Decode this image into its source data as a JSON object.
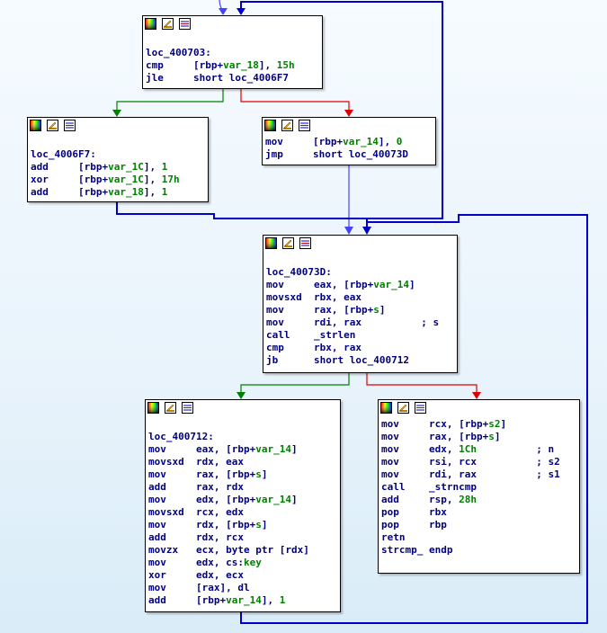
{
  "colors": {
    "edge_true": "#008000",
    "edge_false": "#e00000",
    "edge_flow": "#0000c8",
    "text": "#000080",
    "highlight": "#008000"
  },
  "icons": [
    "graph-color-icon",
    "rename-edit-icon",
    "xrefs-list-icon"
  ],
  "nodes": [
    {
      "id": "n1",
      "lines": [
        {
          "label": "loc_400703:"
        },
        {
          "mn": "cmp",
          "ops": [
            {
              "t": "[rbp+"
            },
            {
              "t": "var_18",
              "v": true
            },
            {
              "t": "], "
            },
            {
              "t": "15h",
              "v": true
            }
          ]
        },
        {
          "mn": "jle",
          "ops": [
            {
              "t": "short loc_4006F7"
            }
          ]
        }
      ]
    },
    {
      "id": "n2",
      "lines": [
        {
          "label": "loc_4006F7:"
        },
        {
          "mn": "add",
          "ops": [
            {
              "t": "[rbp+"
            },
            {
              "t": "var_1C",
              "v": true
            },
            {
              "t": "], "
            },
            {
              "t": "1",
              "v": true
            }
          ]
        },
        {
          "mn": "xor",
          "ops": [
            {
              "t": "[rbp+"
            },
            {
              "t": "var_1C",
              "v": true
            },
            {
              "t": "], "
            },
            {
              "t": "17h",
              "v": true
            }
          ]
        },
        {
          "mn": "add",
          "ops": [
            {
              "t": "[rbp+"
            },
            {
              "t": "var_18",
              "v": true
            },
            {
              "t": "], "
            },
            {
              "t": "1",
              "v": true
            }
          ]
        }
      ]
    },
    {
      "id": "n3",
      "lines": [
        {
          "mn": "mov",
          "ops": [
            {
              "t": "[rbp+"
            },
            {
              "t": "var_14",
              "v": true
            },
            {
              "t": "], "
            },
            {
              "t": "0",
              "v": true
            }
          ]
        },
        {
          "mn": "jmp",
          "ops": [
            {
              "t": "short loc_40073D"
            }
          ]
        }
      ]
    },
    {
      "id": "n4",
      "lines": [
        {
          "label": "loc_40073D:"
        },
        {
          "mn": "mov",
          "ops": [
            {
              "t": "eax, [rbp+"
            },
            {
              "t": "var_14",
              "v": true
            },
            {
              "t": "]"
            }
          ]
        },
        {
          "mn": "movsxd",
          "ops": [
            {
              "t": "rbx, eax"
            }
          ]
        },
        {
          "mn": "mov",
          "ops": [
            {
              "t": "rax, [rbp+"
            },
            {
              "t": "s",
              "v": true
            },
            {
              "t": "]"
            }
          ]
        },
        {
          "mn": "mov",
          "ops": [
            {
              "t": "rdi, rax"
            }
          ],
          "cmt": "; s"
        },
        {
          "mn": "call",
          "ops": [
            {
              "t": "_strlen"
            }
          ]
        },
        {
          "mn": "cmp",
          "ops": [
            {
              "t": "rbx, rax"
            }
          ]
        },
        {
          "mn": "jb",
          "ops": [
            {
              "t": "short loc_400712"
            }
          ]
        }
      ]
    },
    {
      "id": "n5",
      "lines": [
        {
          "label": "loc_400712:"
        },
        {
          "mn": "mov",
          "ops": [
            {
              "t": "eax, [rbp+"
            },
            {
              "t": "var_14",
              "v": true
            },
            {
              "t": "]"
            }
          ]
        },
        {
          "mn": "movsxd",
          "ops": [
            {
              "t": "rdx, eax"
            }
          ]
        },
        {
          "mn": "mov",
          "ops": [
            {
              "t": "rax, [rbp+"
            },
            {
              "t": "s",
              "v": true
            },
            {
              "t": "]"
            }
          ]
        },
        {
          "mn": "add",
          "ops": [
            {
              "t": "rax, rdx"
            }
          ]
        },
        {
          "mn": "mov",
          "ops": [
            {
              "t": "edx, [rbp+"
            },
            {
              "t": "var_14",
              "v": true
            },
            {
              "t": "]"
            }
          ]
        },
        {
          "mn": "movsxd",
          "ops": [
            {
              "t": "rcx, edx"
            }
          ]
        },
        {
          "mn": "mov",
          "ops": [
            {
              "t": "rdx, [rbp+"
            },
            {
              "t": "s",
              "v": true
            },
            {
              "t": "]"
            }
          ]
        },
        {
          "mn": "add",
          "ops": [
            {
              "t": "rdx, rcx"
            }
          ]
        },
        {
          "mn": "movzx",
          "ops": [
            {
              "t": "ecx, byte ptr [rdx]"
            }
          ]
        },
        {
          "mn": "mov",
          "ops": [
            {
              "t": "edx, cs:"
            },
            {
              "t": "key",
              "v": true
            }
          ]
        },
        {
          "mn": "xor",
          "ops": [
            {
              "t": "edx, ecx"
            }
          ]
        },
        {
          "mn": "mov",
          "ops": [
            {
              "t": "[rax], dl"
            }
          ]
        },
        {
          "mn": "add",
          "ops": [
            {
              "t": "[rbp+"
            },
            {
              "t": "var_14",
              "v": true
            },
            {
              "t": "], "
            },
            {
              "t": "1",
              "v": true
            }
          ]
        }
      ]
    },
    {
      "id": "n6",
      "lines": [
        {
          "mn": "mov",
          "ops": [
            {
              "t": "rcx, [rbp+"
            },
            {
              "t": "s2",
              "v": true
            },
            {
              "t": "]"
            }
          ]
        },
        {
          "mn": "mov",
          "ops": [
            {
              "t": "rax, [rbp+"
            },
            {
              "t": "s",
              "v": true
            },
            {
              "t": "]"
            }
          ]
        },
        {
          "mn": "mov",
          "ops": [
            {
              "t": "edx, "
            },
            {
              "t": "1Ch",
              "v": true
            }
          ],
          "cmt": "; n"
        },
        {
          "mn": "mov",
          "ops": [
            {
              "t": "rsi, rcx"
            }
          ],
          "cmt": "; s2"
        },
        {
          "mn": "mov",
          "ops": [
            {
              "t": "rdi, rax"
            }
          ],
          "cmt": "; s1"
        },
        {
          "mn": "call",
          "ops": [
            {
              "t": "_strncmp"
            }
          ]
        },
        {
          "mn": "add",
          "ops": [
            {
              "t": "rsp, "
            },
            {
              "t": "28h",
              "v": true
            }
          ]
        },
        {
          "mn": "pop",
          "ops": [
            {
              "t": "rbx"
            }
          ]
        },
        {
          "mn": "pop",
          "ops": [
            {
              "t": "rbp"
            }
          ]
        },
        {
          "mn": "retn",
          "ops": []
        },
        {
          "label": "strcmp_ endp"
        }
      ]
    }
  ]
}
